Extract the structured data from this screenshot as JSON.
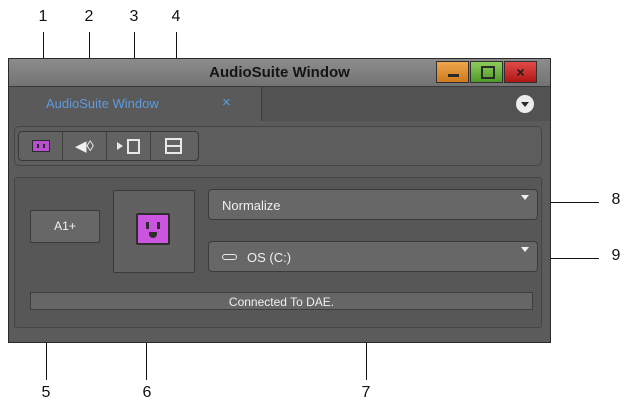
{
  "callouts": [
    "1",
    "2",
    "3",
    "4",
    "5",
    "6",
    "7",
    "8",
    "9"
  ],
  "window": {
    "title": "AudioSuite Window",
    "minimize_icon": "minimize-icon",
    "maximize_icon": "maximize-icon",
    "close_glyph": "×"
  },
  "tab": {
    "label": "AudioSuite Window",
    "close_glyph": "×",
    "menu_icon": "chevron-down-icon"
  },
  "toolbar": {
    "buttons": [
      {
        "icon": "plugin-icon"
      },
      {
        "icon": "preview-audio-icon",
        "glyph": "◀◊"
      },
      {
        "icon": "render-video-icon"
      },
      {
        "icon": "split-view-icon"
      }
    ]
  },
  "panel": {
    "track_button": "A1+",
    "plugin_icon": "plugin-icon",
    "plugin_dropdown": "Normalize",
    "drive_dropdown": "OS (C:)",
    "status": "Connected To DAE."
  },
  "colors": {
    "plugin": "#cc55e0",
    "tab_text": "#5c9be0",
    "min": "#e0922f",
    "max": "#6fb644",
    "close": "#c82a2a"
  }
}
